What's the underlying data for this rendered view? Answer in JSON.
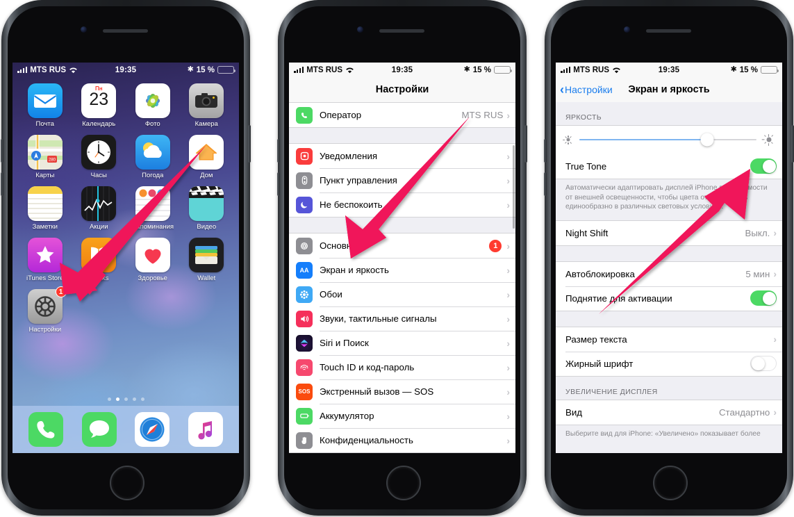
{
  "accent": {
    "arrow": "#f0145a",
    "ios_blue": "#1b7ded",
    "green_on": "#4cd964",
    "badge_red": "#ff3b30",
    "slider_blue": "#7fb5f0"
  },
  "status_bar": {
    "carrier": "MTS RUS",
    "time": "19:35",
    "battery_percent": "15 %",
    "signal_icon": "cellular-bars-icon",
    "wifi_icon": "wifi-icon",
    "bluetooth_icon": "bluetooth-icon",
    "battery_icon": "battery-low-icon"
  },
  "phone1": {
    "name": "home-screen",
    "apps": [
      {
        "label": "Почта",
        "icon": "mail-icon"
      },
      {
        "label": "Календарь",
        "icon": "calendar-icon",
        "day_name": "Пн",
        "day_num": "23"
      },
      {
        "label": "Фото",
        "icon": "photos-icon"
      },
      {
        "label": "Камера",
        "icon": "camera-icon"
      },
      {
        "label": "Карты",
        "icon": "maps-icon"
      },
      {
        "label": "Часы",
        "icon": "clock-icon"
      },
      {
        "label": "Погода",
        "icon": "weather-icon"
      },
      {
        "label": "Дом",
        "icon": "home-app-icon"
      },
      {
        "label": "Заметки",
        "icon": "notes-icon"
      },
      {
        "label": "Акции",
        "icon": "stocks-icon"
      },
      {
        "label": "Напоминания",
        "icon": "reminders-icon"
      },
      {
        "label": "Видео",
        "icon": "videos-icon"
      },
      {
        "label": "iTunes Store",
        "icon": "itunes-store-icon"
      },
      {
        "label": "iBooks",
        "icon": "ibooks-icon"
      },
      {
        "label": "Здоровье",
        "icon": "health-icon"
      },
      {
        "label": "Wallet",
        "icon": "wallet-icon"
      },
      {
        "label": "Настройки",
        "icon": "settings-gear-icon",
        "badge": "1"
      }
    ],
    "page_dots": {
      "count": 5,
      "active_index": 1
    },
    "dock": [
      {
        "label": "Телефон",
        "icon": "phone-icon"
      },
      {
        "label": "Сообщения",
        "icon": "messages-icon"
      },
      {
        "label": "Safari",
        "icon": "safari-compass-icon"
      },
      {
        "label": "Музыка",
        "icon": "music-note-icon"
      }
    ]
  },
  "phone2": {
    "name": "settings-list",
    "nav_title": "Настройки",
    "groups": [
      {
        "rows": [
          {
            "label": "Оператор",
            "value": "MTS RUS",
            "icon": "phone-green-icon",
            "chevron": true
          }
        ]
      },
      {
        "rows": [
          {
            "label": "Уведомления",
            "icon": "notifications-icon",
            "chevron": true
          },
          {
            "label": "Пункт управления",
            "icon": "control-center-icon",
            "chevron": true
          },
          {
            "label": "Не беспокоить",
            "icon": "do-not-disturb-moon-icon",
            "chevron": true
          }
        ]
      },
      {
        "rows": [
          {
            "label": "Основные",
            "icon": "general-gear-icon",
            "badge": "1",
            "chevron": true
          },
          {
            "label": "Экран и яркость",
            "icon": "display-brightness-icon",
            "chevron": true
          },
          {
            "label": "Обои",
            "icon": "wallpaper-icon",
            "chevron": true
          },
          {
            "label": "Звуки, тактильные сигналы",
            "icon": "sounds-icon",
            "chevron": true
          },
          {
            "label": "Siri и Поиск",
            "icon": "siri-icon",
            "chevron": true
          },
          {
            "label": "Touch ID и код-пароль",
            "icon": "touch-id-icon",
            "chevron": true
          },
          {
            "label": "Экстренный вызов — SOS",
            "icon": "sos-icon",
            "chevron": true
          },
          {
            "label": "Аккумулятор",
            "icon": "battery-green-icon",
            "chevron": true
          },
          {
            "label": "Конфиденциальность",
            "icon": "privacy-hand-icon",
            "chevron": true
          }
        ]
      }
    ]
  },
  "phone3": {
    "name": "display-and-brightness",
    "nav_back_label": "Настройки",
    "nav_title": "Экран и яркость",
    "section_brightness_header": "ЯРКОСТЬ",
    "brightness_value_percent": 72,
    "brightness_low_icon": "brightness-low-sun-icon",
    "brightness_high_icon": "brightness-high-sun-icon",
    "true_tone": {
      "label": "True Tone",
      "state": "on"
    },
    "true_tone_footnote": "Автоматически адаптировать дисплей iPhone в зависимости от внешней освещенности, чтобы цвета отображались единообразно в различных световых условиях.",
    "night_shift": {
      "label": "Night Shift",
      "value": "Выкл.",
      "chevron": true
    },
    "autolock": {
      "label": "Автоблокировка",
      "value": "5 мин",
      "chevron": true
    },
    "raise_to_wake": {
      "label": "Поднятие для активации",
      "state": "on"
    },
    "text_size": {
      "label": "Размер текста",
      "chevron": true
    },
    "bold_text": {
      "label": "Жирный шрифт",
      "state": "off"
    },
    "section_zoom_header": "УВЕЛИЧЕНИЕ ДИСПЛЕЯ",
    "view": {
      "label": "Вид",
      "value": "Стандартно",
      "chevron": true
    },
    "view_footnote": "Выберите вид для iPhone: «Увеличено» показывает более"
  },
  "annotations": [
    {
      "name": "arrow-to-settings-app",
      "from": "home-app-icon",
      "to": "settings-gear-icon"
    },
    {
      "name": "arrow-to-display-row",
      "from": "carrier-row",
      "to": "display-brightness-row"
    },
    {
      "name": "arrow-to-true-tone-toggle",
      "from": "raise-to-wake",
      "to": "true-tone-toggle"
    }
  ]
}
